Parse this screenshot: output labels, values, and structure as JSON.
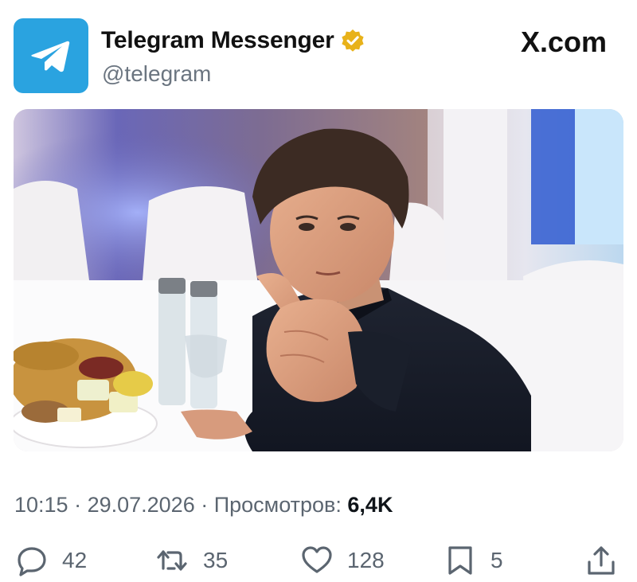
{
  "header": {
    "name": "Telegram Messenger",
    "handle": "@telegram",
    "brand": "X.com",
    "verified": true
  },
  "post": {
    "image_icon": "photo",
    "time": "10:15",
    "sep1": " · ",
    "date": "29.07.2026",
    "sep2": " · ",
    "views_label": "Просмотров:",
    "views_value": "6,4K"
  },
  "actions": {
    "replies": "42",
    "reposts": "35",
    "likes": "128",
    "bookmarks": "5"
  },
  "colors": {
    "avatar_bg": "#2aa3e0",
    "verified_badge": "#e8b21a",
    "text_primary": "#0f1419",
    "text_secondary": "#5b6570"
  }
}
